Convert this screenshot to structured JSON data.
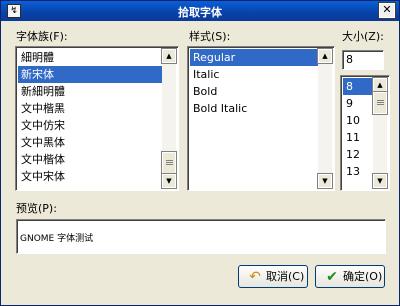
{
  "window": {
    "title": "拾取字体",
    "icon_text": "↯",
    "close_label": "✕"
  },
  "family": {
    "label": "字体族(F):",
    "items": [
      "細明體",
      "新宋体",
      "新細明體",
      "文中楷黑",
      "文中仿宋",
      "文中黑体",
      "文中楷体",
      "文中宋体"
    ],
    "selected_index": 1
  },
  "style": {
    "label": "样式(S):",
    "items": [
      "Regular",
      "Italic",
      "Bold",
      "Bold Italic"
    ],
    "selected_index": 0
  },
  "size": {
    "label": "大小(Z):",
    "value": "8",
    "items": [
      "8",
      "9",
      "10",
      "11",
      "12",
      "13"
    ],
    "selected_index": 0
  },
  "preview": {
    "label": "预览(P):",
    "text": "GNOME 字体测试"
  },
  "buttons": {
    "cancel": "取消(C)",
    "ok": "确定(O)"
  },
  "icons": {
    "cancel": "undo-arrow-icon",
    "ok": "checkmark-icon",
    "up": "arrow-up-icon",
    "down": "arrow-down-icon"
  }
}
